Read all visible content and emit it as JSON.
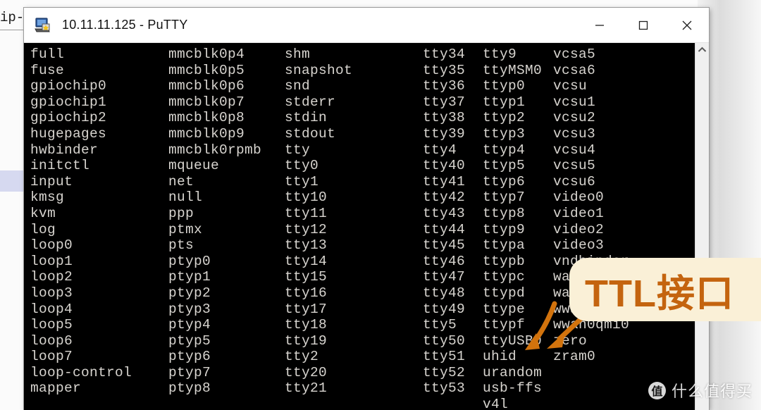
{
  "background": {
    "truncated_text": "ip-",
    "note_color": "#d6d9f0"
  },
  "window": {
    "title": "10.11.11.125 - PuTTY",
    "icon": "putty-computer-icon",
    "controls": {
      "minimize": "—",
      "maximize": "☐",
      "close": "✕"
    },
    "scrollbar": {
      "up_arrow": "ⱏ"
    }
  },
  "terminal": {
    "background_color": "#000000",
    "foreground_color": "#d7d4cf",
    "columns": [
      {
        "name": "column-1",
        "entries": [
          "full",
          "fuse",
          "gpiochip0",
          "gpiochip1",
          "gpiochip2",
          "hugepages",
          "hwbinder",
          "initctl",
          "input",
          "kmsg",
          "kvm",
          "log",
          "loop0",
          "loop1",
          "loop2",
          "loop3",
          "loop4",
          "loop5",
          "loop6",
          "loop7",
          "loop-control",
          "mapper",
          ""
        ]
      },
      {
        "name": "column-2",
        "entries": [
          "mmcblk0p4",
          "mmcblk0p5",
          "mmcblk0p6",
          "mmcblk0p7",
          "mmcblk0p8",
          "mmcblk0p9",
          "mmcblk0rpmb",
          "mqueue",
          "net",
          "null",
          "ppp",
          "ptmx",
          "pts",
          "ptyp0",
          "ptyp1",
          "ptyp2",
          "ptyp3",
          "ptyp4",
          "ptyp5",
          "ptyp6",
          "ptyp7",
          "ptyp8",
          ""
        ]
      },
      {
        "name": "column-3",
        "entries": [
          "shm",
          "snapshot",
          "snd",
          "stderr",
          "stdin",
          "stdout",
          "tty",
          "tty0",
          "tty1",
          "tty10",
          "tty11",
          "tty12",
          "tty13",
          "tty14",
          "tty15",
          "tty16",
          "tty17",
          "tty18",
          "tty19",
          "tty2",
          "tty20",
          "tty21",
          ""
        ]
      },
      {
        "name": "column-4",
        "entries": [
          "tty34",
          "tty35",
          "tty36",
          "tty37",
          "tty38",
          "tty39",
          "tty4",
          "tty40",
          "tty41",
          "tty42",
          "tty43",
          "tty44",
          "tty45",
          "tty46",
          "tty47",
          "tty48",
          "tty49",
          "tty5",
          "tty50",
          "tty51",
          "tty52",
          "tty53",
          ""
        ]
      },
      {
        "name": "column-5",
        "entries": [
          "tty9",
          "ttyMSM0",
          "ttyp0",
          "ttyp1",
          "ttyp2",
          "ttyp3",
          "ttyp4",
          "ttyp5",
          "ttyp6",
          "ttyp7",
          "ttyp8",
          "ttyp9",
          "ttypa",
          "ttypb",
          "ttypc",
          "ttypd",
          "ttype",
          "ttypf",
          "ttyUSB0",
          "uhid",
          "urandom",
          "usb-ffs",
          "v4l"
        ]
      },
      {
        "name": "column-6",
        "entries": [
          "vcsa5",
          "vcsa6",
          "vcsu",
          "vcsu1",
          "vcsu2",
          "vcsu3",
          "vcsu4",
          "vcsu5",
          "vcsu6",
          "video0",
          "video1",
          "video2",
          "video3",
          "vndbinder",
          "wakeup",
          "wakeup0",
          "wwan0qmi0",
          "wwan0qmi0",
          "zero",
          "zram0",
          "",
          "",
          ""
        ]
      }
    ]
  },
  "annotation": {
    "callout_text": "TTL接口",
    "callout_bg": "#faf0d7",
    "callout_fg": "#c4640f",
    "arrow_color": "#d2730d",
    "points_at": "ttyUSB0"
  },
  "watermark": {
    "badge": "值",
    "text": "什么值得买"
  }
}
